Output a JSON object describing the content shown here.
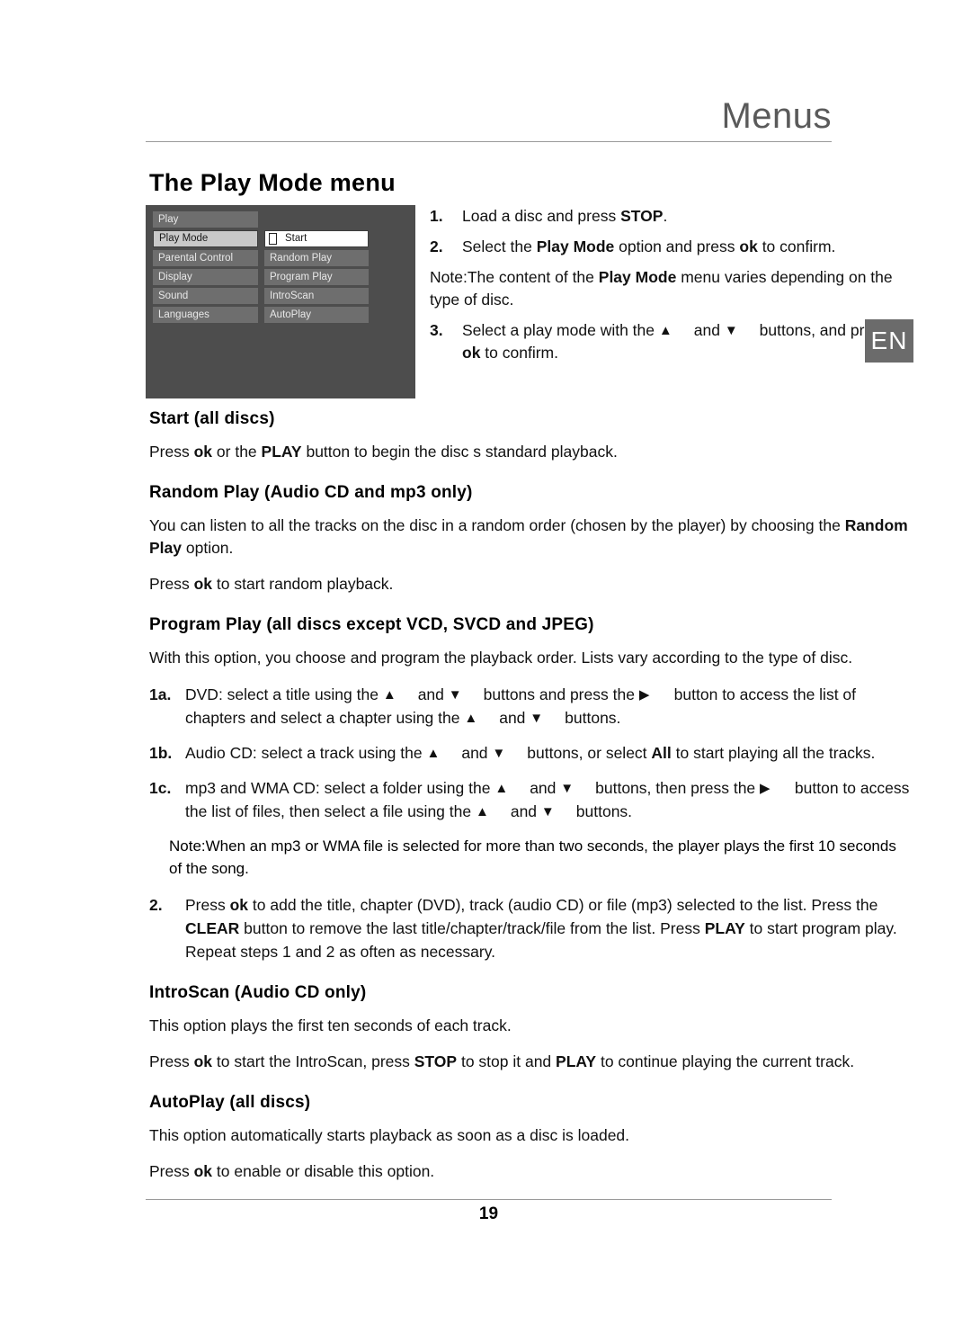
{
  "header": {
    "running_title": "Menus"
  },
  "page_title": "The Play Mode menu",
  "osd": {
    "left_column": [
      {
        "label": "Play",
        "state": "normal"
      },
      {
        "label": "Play Mode",
        "state": "selected"
      },
      {
        "label": "Parental Control",
        "state": "normal"
      },
      {
        "label": "Display",
        "state": "normal"
      },
      {
        "label": "Sound",
        "state": "normal"
      },
      {
        "label": "Languages",
        "state": "normal"
      }
    ],
    "right_column": [
      {
        "label": "Start",
        "state": "highlighted",
        "checkbox": true
      },
      {
        "label": "Random Play",
        "state": "normal"
      },
      {
        "label": "Program Play",
        "state": "normal"
      },
      {
        "label": "IntroScan",
        "state": "normal"
      },
      {
        "label": "AutoPlay",
        "state": "normal"
      }
    ],
    "colors": {
      "background": "#4d4d4d",
      "item": "#6e6e6e",
      "item_text": "#e8e8e8",
      "selected_left": "#c9c9c9",
      "selected_right": "#ffffff"
    }
  },
  "steps": [
    {
      "marker": "1.",
      "text_a": "Load a disc and press ",
      "bold_a": "STOP",
      "text_b": "."
    },
    {
      "marker": "2.",
      "text_a": "Select the ",
      "bold_a": "Play Mode",
      "text_b": " option and press ",
      "bold_b": "ok",
      "text_c": " to confirm."
    }
  ],
  "step_note": {
    "lead": "Note:",
    "text_a": "The content of the ",
    "bold_a": "Play Mode",
    "text_b": " menu varies depending on the type of disc."
  },
  "step3": {
    "marker": "3.",
    "text_a": "Select a play mode with the ",
    "arrow_up": "▲",
    "text_b": " and ",
    "arrow_down": "▼",
    "text_c": " buttons, and press ",
    "bold_a": "ok",
    "text_d": " to confirm."
  },
  "en_badge": "EN",
  "sections": [
    {
      "heading": "Start (all discs)",
      "paragraphs": [
        {
          "parts": [
            {
              "t": "Press ",
              "b": false
            },
            {
              "t": "ok",
              "b": true
            },
            {
              "t": " or the ",
              "b": false
            },
            {
              "t": "PLAY",
              "b": true
            },
            {
              "t": " button to begin the disc s standard playback.",
              "b": false
            }
          ]
        }
      ]
    },
    {
      "heading": "Random Play (Audio CD and mp3 only)",
      "paragraphs": [
        {
          "parts": [
            {
              "t": "You can listen to all the tracks on the disc in a random order (chosen by the player) by choosing the ",
              "b": false
            },
            {
              "t": "Random Play",
              "b": true
            },
            {
              "t": " option.",
              "b": false
            }
          ]
        },
        {
          "parts": [
            {
              "t": "Press ",
              "b": false
            },
            {
              "t": "ok",
              "b": true
            },
            {
              "t": " to start random playback.",
              "b": false
            }
          ]
        }
      ]
    },
    {
      "heading": "Program Play (all discs except VCD, SVCD and JPEG)",
      "paragraphs": [
        {
          "parts": [
            {
              "t": "With this option, you choose and program the playback order. Lists vary according to the type of disc.",
              "b": false
            }
          ]
        }
      ]
    }
  ],
  "program_items": [
    {
      "marker": "1a.",
      "text_a": "DVD: select a title using the ",
      "arrow_1": "▲",
      "text_b": " and ",
      "arrow_2": "▼",
      "text_c": " buttons and press the ",
      "arrow_3": "▶",
      "text_d": " button to access the list of chapters and select a chapter using the ",
      "arrow_4": "▲",
      "text_e": " and ",
      "arrow_5": "▼",
      "text_f": " buttons."
    },
    {
      "marker": "1b.",
      "text_a": "Audio CD: select a track using the ",
      "arrow_1": "▲",
      "text_b": " and ",
      "arrow_2": "▼",
      "text_c": " buttons, or select ",
      "bold_a": "All",
      "text_d": " to start playing all the tracks."
    },
    {
      "marker": "1c.",
      "text_a": "mp3 and WMA CD: select a folder using the ",
      "arrow_1": "▲",
      "text_b": " and ",
      "arrow_2": "▼",
      "text_c": " buttons, then press the ",
      "arrow_3": "▶",
      "text_d": " button to access the list of files, then select a file using the ",
      "arrow_4": "▲",
      "text_e": " and ",
      "arrow_5": "▼",
      "text_f": " buttons."
    }
  ],
  "program_note": {
    "lead": "Note:",
    "text": "When an mp3 or WMA file is selected for more than two seconds, the player plays the first 10 seconds of the song."
  },
  "program_step2": {
    "marker": "2.",
    "parts": [
      {
        "t": "Press ",
        "b": false
      },
      {
        "t": "ok",
        "b": true
      },
      {
        "t": " to add the title, chapter (DVD), track (audio CD) or file (mp3) selected to the list. Press the ",
        "b": false
      },
      {
        "t": "CLEAR",
        "b": true
      },
      {
        "t": " button to remove the last title/chapter/track/file from the list. Press ",
        "b": false
      },
      {
        "t": "PLAY",
        "b": true
      },
      {
        "t": " to start program play. Repeat steps 1 and 2 as often as necessary.",
        "b": false
      }
    ]
  },
  "sections_tail": [
    {
      "heading": "IntroScan (Audio CD only)",
      "paragraphs": [
        {
          "parts": [
            {
              "t": "This option plays the first ten seconds of each track.",
              "b": false
            }
          ]
        },
        {
          "parts": [
            {
              "t": "Press ",
              "b": false
            },
            {
              "t": "ok",
              "b": true
            },
            {
              "t": " to start the IntroScan, press ",
              "b": false
            },
            {
              "t": "STOP",
              "b": true
            },
            {
              "t": " to stop it and ",
              "b": false
            },
            {
              "t": "PLAY",
              "b": true
            },
            {
              "t": " to continue playing the current track.",
              "b": false
            }
          ]
        }
      ]
    },
    {
      "heading": "AutoPlay (all discs)",
      "paragraphs": [
        {
          "parts": [
            {
              "t": "This option automatically starts playback as soon as a disc is loaded.",
              "b": false
            }
          ]
        },
        {
          "parts": [
            {
              "t": "Press ",
              "b": false
            },
            {
              "t": "ok",
              "b": true
            },
            {
              "t": " to enable or disable this option.",
              "b": false
            }
          ]
        }
      ]
    }
  ],
  "footer": {
    "page_number": "19"
  }
}
